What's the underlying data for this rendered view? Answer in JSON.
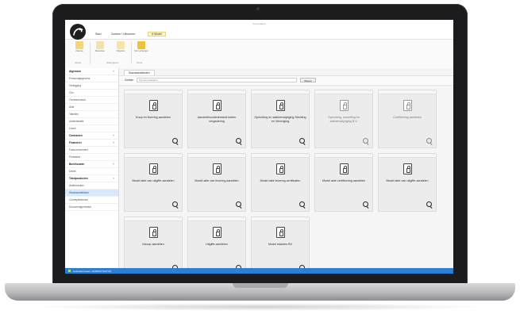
{
  "app": {
    "title": "Kennisbank"
  },
  "ribbon": {
    "tabs": [
      "Start",
      "Zoeken / Uitvoeren",
      "● Model"
    ],
    "buttons": [
      {
        "label": "Nieuwe",
        "icon": "new-doc-icon"
      },
      {
        "label": "Bewerken",
        "icon": "edit-icon"
      },
      {
        "label": "Vrijgeven",
        "icon": "release-icon"
      },
      {
        "label": "Info verbergen",
        "icon": "info-icon"
      }
    ],
    "groups": [
      "Acties",
      "Weergaven",
      "Tools"
    ]
  },
  "sidebar": {
    "items": [
      {
        "label": "Algemeen",
        "header": true
      },
      {
        "label": "Personalgegevens"
      },
      {
        "label": "Verlegging"
      },
      {
        "label": "Clio"
      },
      {
        "label": "Overeenkomst"
      },
      {
        "label": "Akte"
      },
      {
        "label": "Tabellen"
      },
      {
        "label": "Administratie"
      },
      {
        "label": "Losse"
      },
      {
        "label": "Contracten",
        "header": true
      },
      {
        "label": "Financieel",
        "header": true
      },
      {
        "label": "Factuurnummers"
      },
      {
        "label": "Prestaties"
      },
      {
        "label": "Boekhouden",
        "header": true
      },
      {
        "label": "Debet"
      },
      {
        "label": "Tekstproducten",
        "header": true
      },
      {
        "label": "Akteformulier"
      },
      {
        "label": "Standaardteksten",
        "selected": true
      },
      {
        "label": "Conceptenkeuze"
      },
      {
        "label": "Documentgenerator"
      }
    ]
  },
  "main": {
    "tab": "Standaardteksten",
    "filter": {
      "label": "Zoeken",
      "placeholder": "Typ een zoekterm",
      "button": "Wissen"
    },
    "cards": [
      {
        "title": "Koop en levering aandelen"
      },
      {
        "title": "Aandeelhoudersbesluit buiten vergadering"
      },
      {
        "title": "Oprichting en statutenwijziging Stichting en Vereniging"
      },
      {
        "title": "Oprichting, omzetting en statutenwijziging B.V.",
        "dim": true
      },
      {
        "title": "Certificering aandelen",
        "dim": true
      },
      {
        "title": "Model akte van uitgifte aandelen"
      },
      {
        "title": "Model akte van levering aandelen"
      },
      {
        "title": "Model akte levering certificaten"
      },
      {
        "title": "Model akte certificering aandelen"
      },
      {
        "title": "Model akte van uitgifte aandelen"
      },
      {
        "title": "Inkoop aandelen"
      },
      {
        "title": "Uitgifte aandelen"
      },
      {
        "title": "Model statuten BV"
      }
    ]
  },
  "statusbar": {
    "text": "Gebruikersnaam: ADMINISTRATOR"
  }
}
